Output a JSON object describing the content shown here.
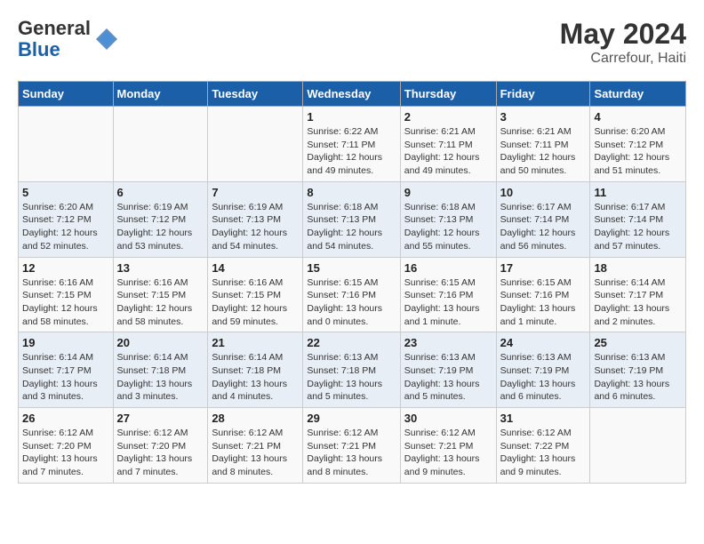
{
  "header": {
    "logo_general": "General",
    "logo_blue": "Blue",
    "month_year": "May 2024",
    "location": "Carrefour, Haiti"
  },
  "weekdays": [
    "Sunday",
    "Monday",
    "Tuesday",
    "Wednesday",
    "Thursday",
    "Friday",
    "Saturday"
  ],
  "weeks": [
    [
      {
        "day": "",
        "info": ""
      },
      {
        "day": "",
        "info": ""
      },
      {
        "day": "",
        "info": ""
      },
      {
        "day": "1",
        "info": "Sunrise: 6:22 AM\nSunset: 7:11 PM\nDaylight: 12 hours\nand 49 minutes."
      },
      {
        "day": "2",
        "info": "Sunrise: 6:21 AM\nSunset: 7:11 PM\nDaylight: 12 hours\nand 49 minutes."
      },
      {
        "day": "3",
        "info": "Sunrise: 6:21 AM\nSunset: 7:11 PM\nDaylight: 12 hours\nand 50 minutes."
      },
      {
        "day": "4",
        "info": "Sunrise: 6:20 AM\nSunset: 7:12 PM\nDaylight: 12 hours\nand 51 minutes."
      }
    ],
    [
      {
        "day": "5",
        "info": "Sunrise: 6:20 AM\nSunset: 7:12 PM\nDaylight: 12 hours\nand 52 minutes."
      },
      {
        "day": "6",
        "info": "Sunrise: 6:19 AM\nSunset: 7:12 PM\nDaylight: 12 hours\nand 53 minutes."
      },
      {
        "day": "7",
        "info": "Sunrise: 6:19 AM\nSunset: 7:13 PM\nDaylight: 12 hours\nand 54 minutes."
      },
      {
        "day": "8",
        "info": "Sunrise: 6:18 AM\nSunset: 7:13 PM\nDaylight: 12 hours\nand 54 minutes."
      },
      {
        "day": "9",
        "info": "Sunrise: 6:18 AM\nSunset: 7:13 PM\nDaylight: 12 hours\nand 55 minutes."
      },
      {
        "day": "10",
        "info": "Sunrise: 6:17 AM\nSunset: 7:14 PM\nDaylight: 12 hours\nand 56 minutes."
      },
      {
        "day": "11",
        "info": "Sunrise: 6:17 AM\nSunset: 7:14 PM\nDaylight: 12 hours\nand 57 minutes."
      }
    ],
    [
      {
        "day": "12",
        "info": "Sunrise: 6:16 AM\nSunset: 7:15 PM\nDaylight: 12 hours\nand 58 minutes."
      },
      {
        "day": "13",
        "info": "Sunrise: 6:16 AM\nSunset: 7:15 PM\nDaylight: 12 hours\nand 58 minutes."
      },
      {
        "day": "14",
        "info": "Sunrise: 6:16 AM\nSunset: 7:15 PM\nDaylight: 12 hours\nand 59 minutes."
      },
      {
        "day": "15",
        "info": "Sunrise: 6:15 AM\nSunset: 7:16 PM\nDaylight: 13 hours\nand 0 minutes."
      },
      {
        "day": "16",
        "info": "Sunrise: 6:15 AM\nSunset: 7:16 PM\nDaylight: 13 hours\nand 1 minute."
      },
      {
        "day": "17",
        "info": "Sunrise: 6:15 AM\nSunset: 7:16 PM\nDaylight: 13 hours\nand 1 minute."
      },
      {
        "day": "18",
        "info": "Sunrise: 6:14 AM\nSunset: 7:17 PM\nDaylight: 13 hours\nand 2 minutes."
      }
    ],
    [
      {
        "day": "19",
        "info": "Sunrise: 6:14 AM\nSunset: 7:17 PM\nDaylight: 13 hours\nand 3 minutes."
      },
      {
        "day": "20",
        "info": "Sunrise: 6:14 AM\nSunset: 7:18 PM\nDaylight: 13 hours\nand 3 minutes."
      },
      {
        "day": "21",
        "info": "Sunrise: 6:14 AM\nSunset: 7:18 PM\nDaylight: 13 hours\nand 4 minutes."
      },
      {
        "day": "22",
        "info": "Sunrise: 6:13 AM\nSunset: 7:18 PM\nDaylight: 13 hours\nand 5 minutes."
      },
      {
        "day": "23",
        "info": "Sunrise: 6:13 AM\nSunset: 7:19 PM\nDaylight: 13 hours\nand 5 minutes."
      },
      {
        "day": "24",
        "info": "Sunrise: 6:13 AM\nSunset: 7:19 PM\nDaylight: 13 hours\nand 6 minutes."
      },
      {
        "day": "25",
        "info": "Sunrise: 6:13 AM\nSunset: 7:19 PM\nDaylight: 13 hours\nand 6 minutes."
      }
    ],
    [
      {
        "day": "26",
        "info": "Sunrise: 6:12 AM\nSunset: 7:20 PM\nDaylight: 13 hours\nand 7 minutes."
      },
      {
        "day": "27",
        "info": "Sunrise: 6:12 AM\nSunset: 7:20 PM\nDaylight: 13 hours\nand 7 minutes."
      },
      {
        "day": "28",
        "info": "Sunrise: 6:12 AM\nSunset: 7:21 PM\nDaylight: 13 hours\nand 8 minutes."
      },
      {
        "day": "29",
        "info": "Sunrise: 6:12 AM\nSunset: 7:21 PM\nDaylight: 13 hours\nand 8 minutes."
      },
      {
        "day": "30",
        "info": "Sunrise: 6:12 AM\nSunset: 7:21 PM\nDaylight: 13 hours\nand 9 minutes."
      },
      {
        "day": "31",
        "info": "Sunrise: 6:12 AM\nSunset: 7:22 PM\nDaylight: 13 hours\nand 9 minutes."
      },
      {
        "day": "",
        "info": ""
      }
    ]
  ]
}
